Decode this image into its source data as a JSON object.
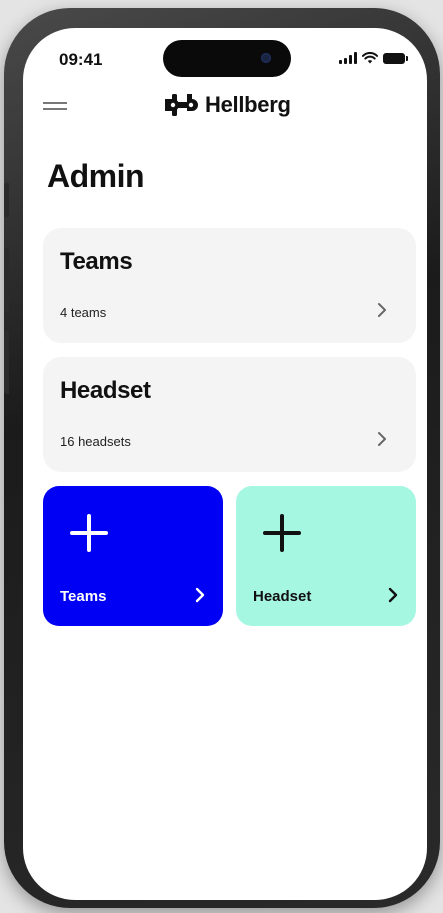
{
  "status_bar": {
    "time": "09:41"
  },
  "header": {
    "brand_name": "Hellberg",
    "menu_icon": "hamburger-menu-icon",
    "logo_icon": "hellberg-logo-icon"
  },
  "page": {
    "title": "Admin"
  },
  "cards": [
    {
      "title": "Teams",
      "subtitle": "4 teams",
      "icon": "chevron-right-icon"
    },
    {
      "title": "Headset",
      "subtitle": "16 headsets",
      "icon": "chevron-right-icon"
    }
  ],
  "quick_actions": [
    {
      "label": "Teams",
      "icon": "plus-icon",
      "background": "#0000f5",
      "foreground": "#ffffff"
    },
    {
      "label": "Headset",
      "icon": "plus-icon",
      "background": "#a6f7e2",
      "foreground": "#111111"
    }
  ],
  "colors": {
    "card_background": "#f4f4f4",
    "text_primary": "#111111"
  }
}
